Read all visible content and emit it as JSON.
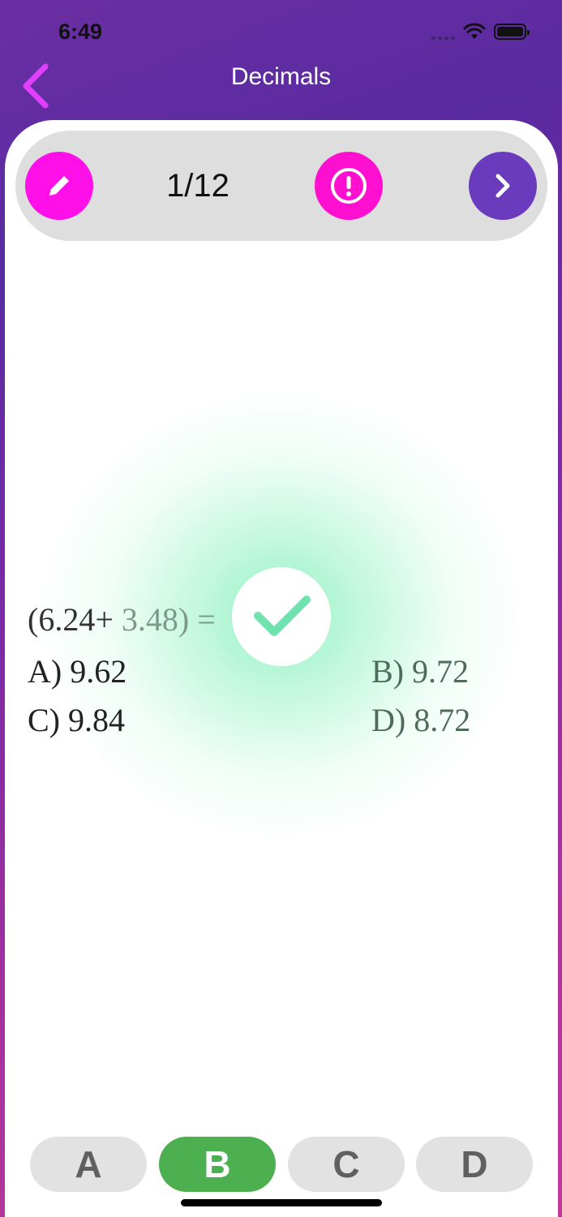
{
  "status": {
    "time": "6:49"
  },
  "nav": {
    "title": "Decimals",
    "back_icon": "chevron-left-icon"
  },
  "toolbar": {
    "progress": "1/12",
    "edit_icon": "pencil-icon",
    "alert_icon": "alert-circle-icon",
    "next_icon": "chevron-right-icon"
  },
  "question": {
    "prefix": "(6.24+",
    "rest": " 3.48) =",
    "options": [
      {
        "label": "A) 9.62"
      },
      {
        "label": "B) 9.72"
      },
      {
        "label": "C) 9.84"
      },
      {
        "label": "D) 8.72"
      }
    ],
    "result_icon": "checkmark-icon"
  },
  "answers": [
    {
      "label": "A",
      "selected": false
    },
    {
      "label": "B",
      "selected": true
    },
    {
      "label": "C",
      "selected": false
    },
    {
      "label": "D",
      "selected": false
    }
  ],
  "colors": {
    "edit": "#ff10e8",
    "alert": "#ff10d0",
    "next": "#6a3bbd",
    "selected_answer": "#4caf50",
    "back_arrow": "#e040fb"
  }
}
